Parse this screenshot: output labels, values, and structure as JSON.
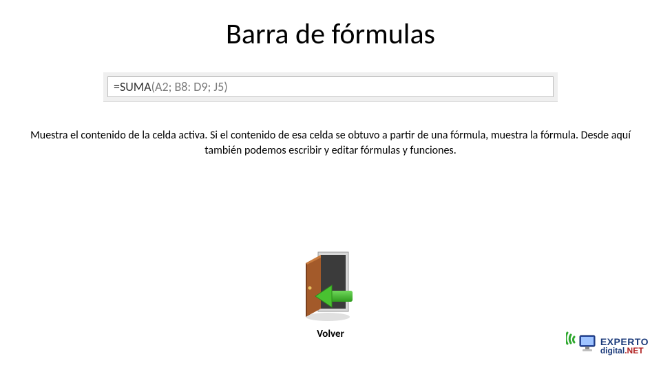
{
  "title": "Barra de fórmulas",
  "formula": {
    "eq": "=",
    "fn": "SUMA",
    "args": "(A2; B8: D9; J5)"
  },
  "description": "Muestra el contenido de la celda activa. Si el contenido de esa celda se obtuvo a partir de una fórmula, muestra la fórmula. Desde aquí también podemos escribir y editar fórmulas y funciones.",
  "back_label": "Volver",
  "logo": {
    "line1": "EXPERTO",
    "line2_plain": "digital",
    "line2_accent": ".NET"
  }
}
